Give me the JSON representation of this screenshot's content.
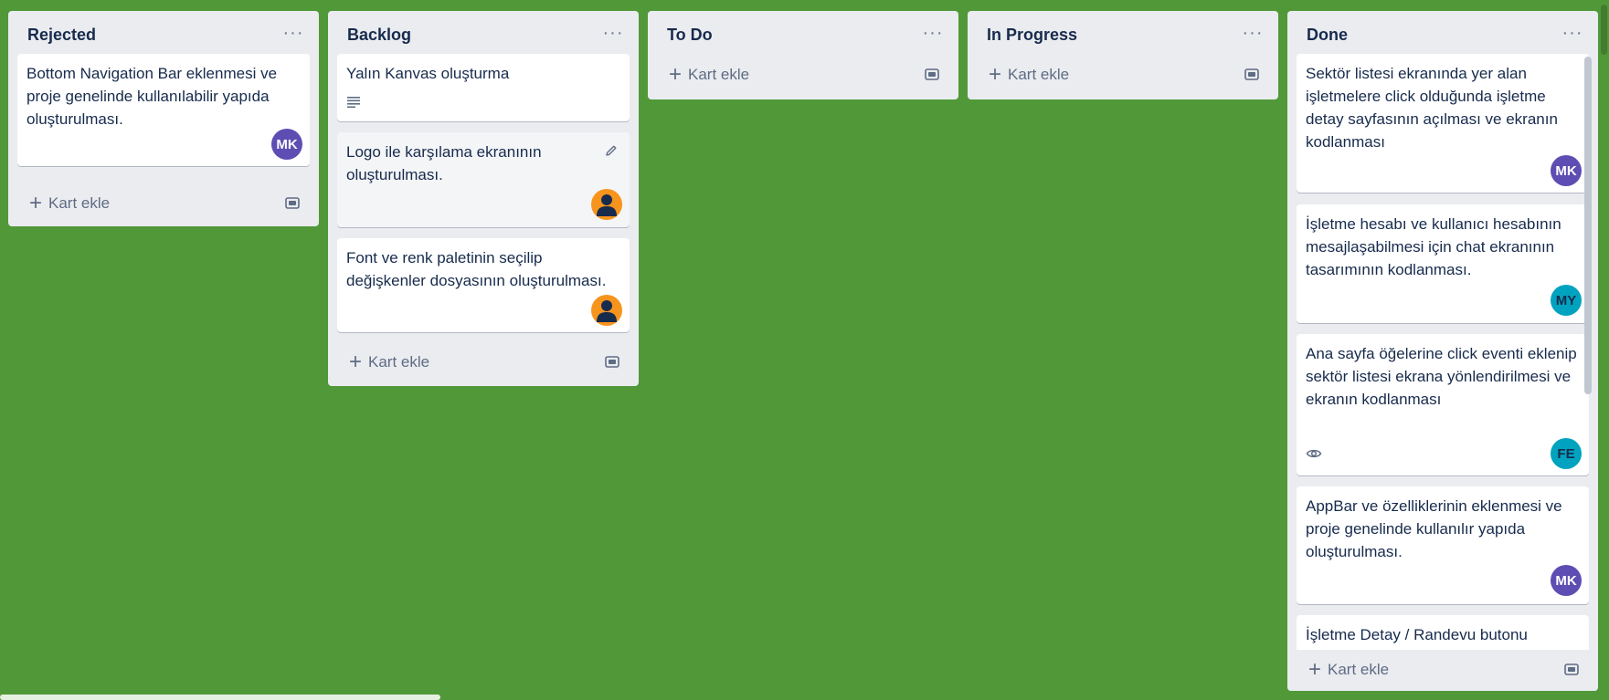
{
  "lists": [
    {
      "title": "Rejected",
      "cards": [
        {
          "title": "Bottom Navigation Bar eklenmesi ve proje genelinde kullanılabilir yapıda oluşturulması.",
          "avatar": "MK"
        }
      ],
      "add_label": "Kart ekle"
    },
    {
      "title": "Backlog",
      "cards": [
        {
          "title": "Yalın Kanvas oluşturma",
          "badge": "description-icon"
        },
        {
          "title": "Logo ile karşılama ekranının oluşturulması.",
          "avatar": "person-icon"
        },
        {
          "title": "Font ve renk paletinin seçilip değişkenler dosyasının oluşturulması.",
          "avatar": "person-icon"
        }
      ],
      "add_label": "Kart ekle"
    },
    {
      "title": "To Do",
      "cards": [],
      "add_label": "Kart ekle"
    },
    {
      "title": "In Progress",
      "cards": [],
      "add_label": "Kart ekle"
    },
    {
      "title": "Done",
      "cards": [
        {
          "title": "Sektör listesi ekranında yer alan işletmelere click olduğunda işletme detay sayfasının açılması ve ekranın kodlanması",
          "avatar": "MK"
        },
        {
          "title": "İşletme hesabı ve kullanıcı hesabının mesajlaşabilmesi için chat ekranının tasarımının kodlanması.",
          "avatar": "MY"
        },
        {
          "title": "Ana sayfa öğelerine click eventi eklenip sektör listesi ekrana yönlendirilmesi ve ekranın kodlanması",
          "avatar": "FE",
          "badge": "eye-icon"
        },
        {
          "title": "AppBar ve özelliklerinin eklenmesi ve proje genelinde kullanılır yapıda oluşturulması.",
          "avatar": "MK"
        },
        {
          "title": "İşletme Detay / Randevu butonu"
        }
      ],
      "add_label": "Kart ekle"
    }
  ],
  "colors": {
    "board_bg": "#519839",
    "list_bg": "#ebecf0",
    "avatar_mk": "#5e4db2",
    "avatar_teal": "#00a3bf",
    "avatar_person": "#f7941d"
  },
  "icons": {
    "menu": "more-horizontal-icon",
    "add": "plus-icon",
    "template": "card-template-icon"
  }
}
